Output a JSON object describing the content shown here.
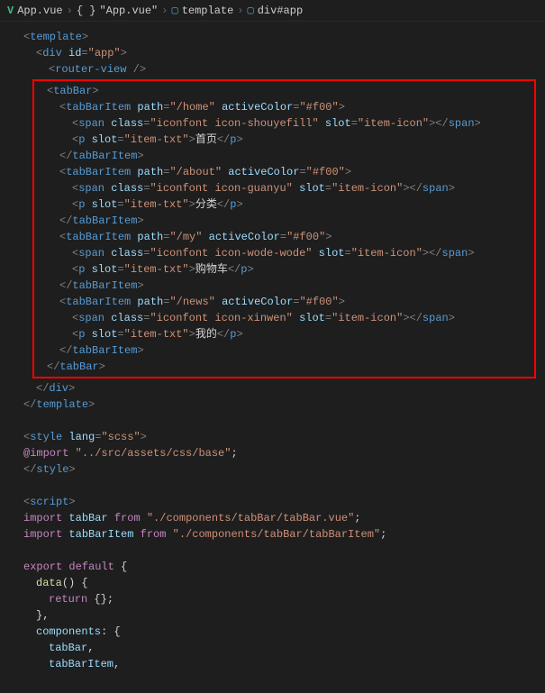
{
  "breadcrumb": {
    "file": "App.vue",
    "json": "\"App.vue\"",
    "template": "template",
    "div": "div#app"
  },
  "code": {
    "template_open": "template",
    "div_open": "div",
    "div_id_attr": "id",
    "div_id_val": "\"app\"",
    "router_view": "router-view",
    "tabBar": "tabBar",
    "tabBarItem": "tabBarItem",
    "path_attr": "path",
    "activeColor_attr": "activeColor",
    "activeColor_val": "\"#f00\"",
    "span": "span",
    "class_attr": "class",
    "slot_attr": "slot",
    "item_icon_val": "\"item-icon\"",
    "item_txt_val": "\"item-txt\"",
    "p_tag": "p",
    "items": [
      {
        "path": "\"/home\"",
        "iconClass": "\"iconfont icon-shouyefill\"",
        "text": "首页"
      },
      {
        "path": "\"/about\"",
        "iconClass": "\"iconfont icon-guanyu\"",
        "text": "分类"
      },
      {
        "path": "\"/my\"",
        "iconClass": "\"iconfont icon-wode-wode\"",
        "text": "购物车"
      },
      {
        "path": "\"/news\"",
        "iconClass": "\"iconfont icon-xinwen\"",
        "text": "我的"
      }
    ],
    "div_close": "div",
    "template_close": "template",
    "style_open": "style",
    "lang_attr": "lang",
    "scss_val": "\"scss\"",
    "import_css": "@import",
    "import_css_val": "\"../src/assets/css/base\"",
    "style_close": "style",
    "script_open": "script",
    "import_kw": "import",
    "from_kw": "from",
    "tabBar_var": "tabBar",
    "tabBar_path": "\"./components/tabBar/tabBar.vue\"",
    "tabBarItem_var": "tabBarItem",
    "tabBarItem_path": "\"./components/tabBar/tabBarItem\"",
    "export_kw": "export",
    "default_kw": "default",
    "data_fn": "data",
    "return_kw": "return",
    "components_key": "components"
  }
}
